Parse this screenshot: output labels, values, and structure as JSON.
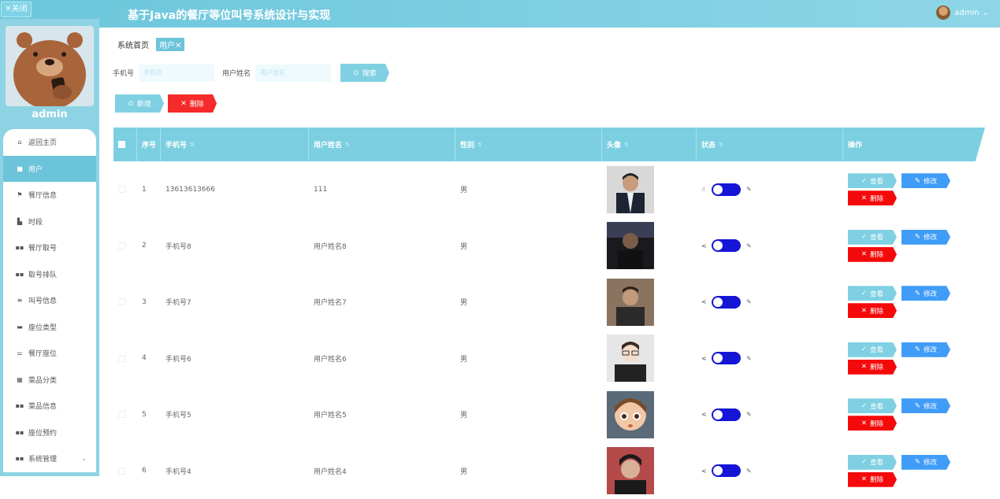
{
  "header": {
    "close_label": "✕关闭",
    "title": "基于Java的餐厅等位叫号系统设计与实现",
    "user": "admin"
  },
  "sidebar": {
    "profile_name": "admin",
    "items": [
      {
        "label": "返回主页",
        "icon": "home-icon"
      },
      {
        "label": "用户",
        "icon": "user-icon"
      },
      {
        "label": "餐厅信息",
        "icon": "flag-icon"
      },
      {
        "label": "时段",
        "icon": "chart-icon"
      },
      {
        "label": "餐厅取号",
        "icon": "grid-icon"
      },
      {
        "label": "取号排队",
        "icon": "grid-icon"
      },
      {
        "label": "叫号信息",
        "icon": "list-icon"
      },
      {
        "label": "座位类型",
        "icon": "card-icon"
      },
      {
        "label": "餐厅座位",
        "icon": "sliders-icon"
      },
      {
        "label": "菜品分类",
        "icon": "grid-icon"
      },
      {
        "label": "菜品信息",
        "icon": "grid-icon"
      },
      {
        "label": "座位预约",
        "icon": "grid-icon"
      },
      {
        "label": "系统管理",
        "icon": "grid-icon"
      }
    ]
  },
  "breadcrumb": {
    "home": "系统首页",
    "current": "用户✕"
  },
  "search": {
    "phone_label": "手机号",
    "phone_placeholder": "手机号",
    "name_label": "用户姓名",
    "name_placeholder": "用户姓名",
    "button": "搜索"
  },
  "actions": {
    "add": "新增",
    "delete": "删除"
  },
  "table": {
    "headers": {
      "index": "序号",
      "phone": "手机号",
      "name": "用户姓名",
      "sex": "性别",
      "photo": "头像",
      "status": "状态",
      "ops": "操作"
    },
    "ops_labels": {
      "view": "查看",
      "edit": "修改",
      "delete": "删除"
    },
    "rows": [
      {
        "index": "1",
        "phone": "13613613666",
        "name": "111",
        "sex": "男"
      },
      {
        "index": "2",
        "phone": "手机号8",
        "name": "用户姓名8",
        "sex": "男"
      },
      {
        "index": "3",
        "phone": "手机号7",
        "name": "用户姓名7",
        "sex": "男"
      },
      {
        "index": "4",
        "phone": "手机号6",
        "name": "用户姓名6",
        "sex": "男"
      },
      {
        "index": "5",
        "phone": "手机号5",
        "name": "用户姓名5",
        "sex": "男"
      },
      {
        "index": "6",
        "phone": "手机号4",
        "name": "用户姓名4",
        "sex": "男"
      }
    ]
  },
  "colors": {
    "primary": "#7fd0e2",
    "edit": "#3f9cf7",
    "danger": "#f40a0a",
    "toggle": "#1515d6"
  }
}
